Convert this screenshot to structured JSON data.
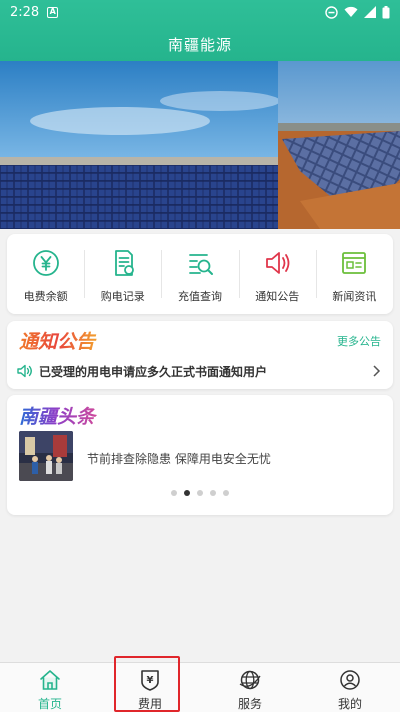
{
  "status": {
    "time": "2:28",
    "notification_letter": "A"
  },
  "header": {
    "title": "南疆能源"
  },
  "quick_actions": [
    {
      "label": "电费余额",
      "icon": "yuan-coin-icon"
    },
    {
      "label": "购电记录",
      "icon": "purchase-record-icon"
    },
    {
      "label": "充值查询",
      "icon": "recharge-search-icon"
    },
    {
      "label": "通知公告",
      "icon": "speaker-icon"
    },
    {
      "label": "新闻资讯",
      "icon": "news-icon"
    }
  ],
  "notice": {
    "heading": "通知公告",
    "more_label": "更多公告",
    "item_text": "已受理的用电申请应多久正式书面通知用户"
  },
  "news": {
    "heading": "南疆头条",
    "item_title": "节前排查除隐患 保障用电安全无忧",
    "carousel": {
      "total": 5,
      "active_index": 1
    }
  },
  "tabbar": [
    {
      "label": "首页",
      "icon": "home-icon",
      "active": true
    },
    {
      "label": "费用",
      "icon": "fee-shield-icon",
      "active": false
    },
    {
      "label": "服务",
      "icon": "globe-icon",
      "active": false
    },
    {
      "label": "我的",
      "icon": "profile-icon",
      "active": false
    }
  ],
  "colors": {
    "accent": "#25b48d",
    "highlight_box": "#e0262b"
  }
}
